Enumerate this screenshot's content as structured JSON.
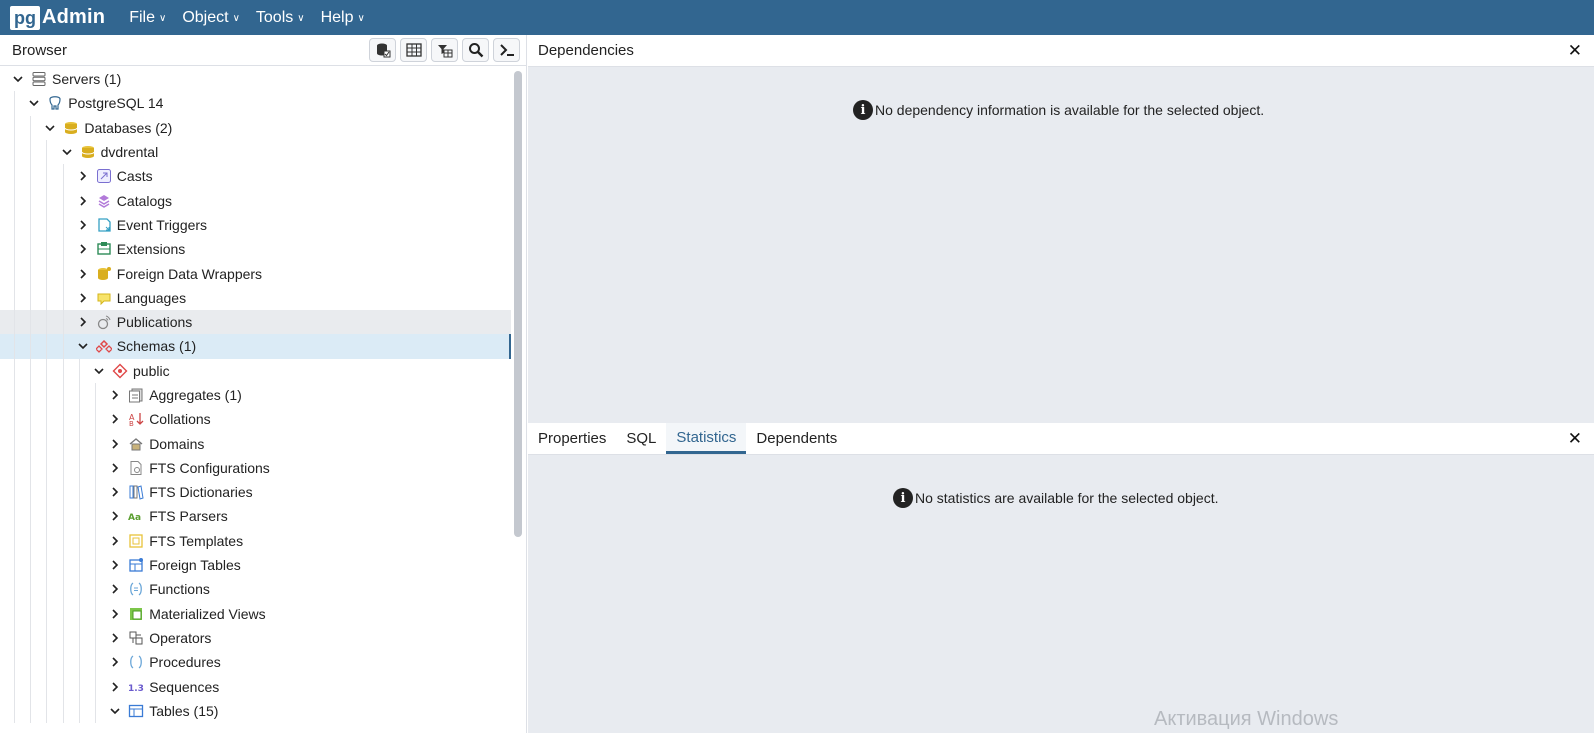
{
  "app": {
    "logo_pg": "pg",
    "logo_admin": "Admin"
  },
  "menu": [
    {
      "label": "File"
    },
    {
      "label": "Object"
    },
    {
      "label": "Tools"
    },
    {
      "label": "Help"
    }
  ],
  "browser": {
    "title": "Browser",
    "toolbar": [
      "query-tool-icon",
      "view-data-icon",
      "filtered-rows-icon",
      "search-objects-icon",
      "psql-tool-icon"
    ],
    "tree": [
      {
        "label": "Servers (1)",
        "level": 0,
        "toggle": "open",
        "icon": "servers-icon"
      },
      {
        "label": "PostgreSQL 14",
        "level": 1,
        "toggle": "open",
        "icon": "postgresql-icon"
      },
      {
        "label": "Databases (2)",
        "level": 2,
        "toggle": "open",
        "icon": "databases-icon"
      },
      {
        "label": "dvdrental",
        "level": 3,
        "toggle": "open",
        "icon": "database-icon"
      },
      {
        "label": "Casts",
        "level": 4,
        "toggle": "closed",
        "icon": "casts-icon"
      },
      {
        "label": "Catalogs",
        "level": 4,
        "toggle": "closed",
        "icon": "catalogs-icon"
      },
      {
        "label": "Event Triggers",
        "level": 4,
        "toggle": "closed",
        "icon": "event-triggers-icon"
      },
      {
        "label": "Extensions",
        "level": 4,
        "toggle": "closed",
        "icon": "extensions-icon"
      },
      {
        "label": "Foreign Data Wrappers",
        "level": 4,
        "toggle": "closed",
        "icon": "foreign-data-wrappers-icon"
      },
      {
        "label": "Languages",
        "level": 4,
        "toggle": "closed",
        "icon": "languages-icon"
      },
      {
        "label": "Publications",
        "level": 4,
        "toggle": "closed",
        "icon": "publications-icon",
        "state": "hover"
      },
      {
        "label": "Schemas (1)",
        "level": 4,
        "toggle": "open",
        "icon": "schemas-icon",
        "state": "selected"
      },
      {
        "label": "public",
        "level": 5,
        "toggle": "open",
        "icon": "schema-icon"
      },
      {
        "label": "Aggregates (1)",
        "level": 6,
        "toggle": "closed",
        "icon": "aggregates-icon"
      },
      {
        "label": "Collations",
        "level": 6,
        "toggle": "closed",
        "icon": "collations-icon"
      },
      {
        "label": "Domains",
        "level": 6,
        "toggle": "closed",
        "icon": "domains-icon"
      },
      {
        "label": "FTS Configurations",
        "level": 6,
        "toggle": "closed",
        "icon": "fts-configurations-icon"
      },
      {
        "label": "FTS Dictionaries",
        "level": 6,
        "toggle": "closed",
        "icon": "fts-dictionaries-icon"
      },
      {
        "label": "FTS Parsers",
        "level": 6,
        "toggle": "closed",
        "icon": "fts-parsers-icon"
      },
      {
        "label": "FTS Templates",
        "level": 6,
        "toggle": "closed",
        "icon": "fts-templates-icon"
      },
      {
        "label": "Foreign Tables",
        "level": 6,
        "toggle": "closed",
        "icon": "foreign-tables-icon"
      },
      {
        "label": "Functions",
        "level": 6,
        "toggle": "closed",
        "icon": "functions-icon"
      },
      {
        "label": "Materialized Views",
        "level": 6,
        "toggle": "closed",
        "icon": "materialized-views-icon"
      },
      {
        "label": "Operators",
        "level": 6,
        "toggle": "closed",
        "icon": "operators-icon"
      },
      {
        "label": "Procedures",
        "level": 6,
        "toggle": "closed",
        "icon": "procedures-icon"
      },
      {
        "label": "Sequences",
        "level": 6,
        "toggle": "closed",
        "icon": "sequences-icon"
      },
      {
        "label": "Tables (15)",
        "level": 6,
        "toggle": "open",
        "icon": "tables-icon"
      }
    ]
  },
  "dependencies": {
    "title": "Dependencies",
    "message": "No dependency information is available for the selected object."
  },
  "bottom_panel": {
    "tabs": [
      {
        "label": "Properties",
        "active": false
      },
      {
        "label": "SQL",
        "active": false
      },
      {
        "label": "Statistics",
        "active": true
      },
      {
        "label": "Dependents",
        "active": false
      }
    ],
    "message": "No statistics are available for the selected object.",
    "watermark": "Активация Windows"
  },
  "colors": {
    "accent": "#326690",
    "panel_bg": "#e8ebf0",
    "selected_bg": "#dbebf6"
  }
}
